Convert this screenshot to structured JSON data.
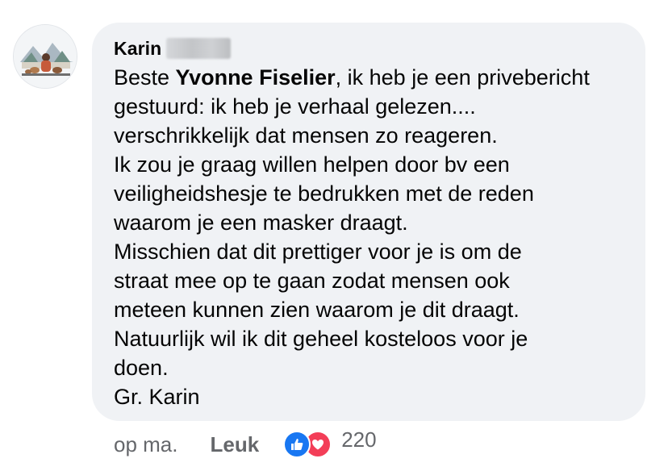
{
  "comment": {
    "author": "Karin",
    "greeting_prefix": "Beste ",
    "mention": "Yvonne Fiselier",
    "body_first_line_rest": ", ik heb je een privebericht",
    "body_rest": "gestuurd: ik heb je verhaal gelezen....\nverschrikkelijk dat mensen zo reageren.\nIk zou je graag willen helpen door bv een\nveiligheidshesje te bedrukken met de reden\nwaarom je een masker draagt.\nMisschien dat dit prettiger voor je is om de\nstraat mee op te gaan zodat mensen ook\nmeteen kunnen zien waarom je dit draagt.\nNatuurlijk wil ik dit geheel kosteloos voor je\ndoen.\nGr. Karin"
  },
  "footer": {
    "time": "op ma.",
    "like_label": "Leuk",
    "reaction_count": "220",
    "reactions": [
      "like-icon",
      "love-icon"
    ]
  },
  "colors": {
    "bubble": "#f0f2f5",
    "meta_text": "#65676b",
    "like_blue": "#1877f2",
    "love_red": "#f33e58"
  }
}
